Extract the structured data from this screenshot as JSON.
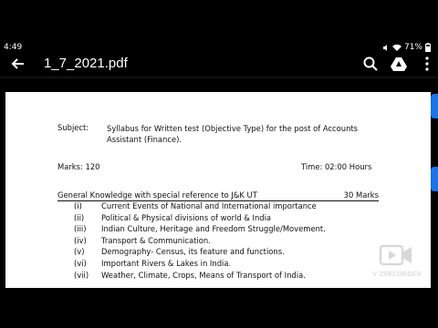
{
  "status": {
    "time": "4:49",
    "battery": "71%"
  },
  "appbar": {
    "title": "1_7_2021.pdf"
  },
  "document": {
    "subject_label": "Subject:",
    "subject_text": "Syllabus for Written test (Objective Type) for the post of Accounts Assistant (Finance).",
    "marks": "Marks: 120",
    "time": "Time: 02:00 Hours",
    "section_title": "General Knowledge with special reference to J&K UT",
    "section_marks": "30 Marks",
    "items": [
      {
        "num": "(i)",
        "text": "Current Events of National and International importance"
      },
      {
        "num": "(ii)",
        "text": "Political & Physical divisions of world & India"
      },
      {
        "num": "(iii)",
        "text": "Indian Culture, Heritage and Freedom Struggle/Movement."
      },
      {
        "num": "(iv)",
        "text": "Transport & Communication."
      },
      {
        "num": "(v)",
        "text": "Demography- Census, its feature and functions."
      },
      {
        "num": "(vi)",
        "text": "Important Rivers & Lakes in India."
      },
      {
        "num": "(vii)",
        "text": "Weather, Climate, Crops, Means of Transport of India."
      }
    ]
  },
  "watermark": {
    "text": "V·ZRECORDER"
  },
  "colors": {
    "accent": "#1a73e8"
  },
  "icons": [
    "back-arrow-icon",
    "search-icon",
    "drive-icon",
    "more-vert-icon",
    "wifi-icon",
    "battery-icon",
    "mute-icon"
  ]
}
